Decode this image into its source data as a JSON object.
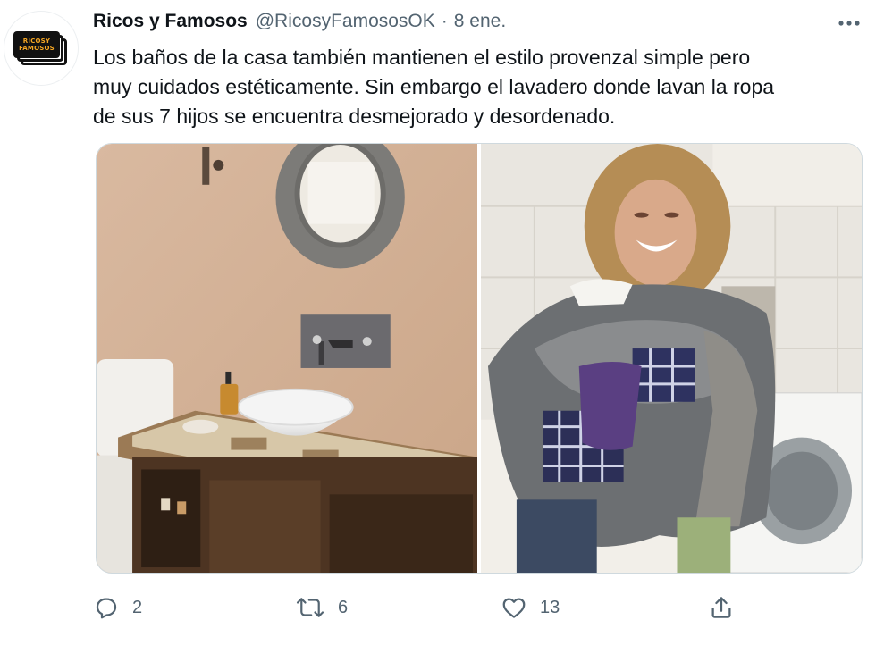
{
  "author": {
    "display_name": "Ricos y Famosos",
    "handle": "@RicosyFamososOK",
    "separator": "·",
    "date": "8 ene.",
    "avatar_text_line1": "RICOSY",
    "avatar_text_line2": "FAMOSOS"
  },
  "tweet": {
    "text_lines": [
      "Los baños de la casa también mantienen el estilo provenzal simple pero",
      "muy cuidados estéticamente. Sin embargo el lavadero donde lavan la ropa",
      "de sus 7 hijos se encuentra desmejorado y desordenado."
    ]
  },
  "media": {
    "photos": [
      {
        "subject": "bathroom-vanity"
      },
      {
        "subject": "woman-holding-laundry"
      }
    ]
  },
  "actions": {
    "reply_count": "2",
    "retweet_count": "6",
    "like_count": "13"
  },
  "icons": [
    "more-icon",
    "reply-icon",
    "retweet-icon",
    "like-icon",
    "share-icon"
  ],
  "colors": {
    "text_primary": "#0f1419",
    "text_secondary": "#536471",
    "border": "#cfd9de",
    "avatar_accent": "#f5a623"
  }
}
